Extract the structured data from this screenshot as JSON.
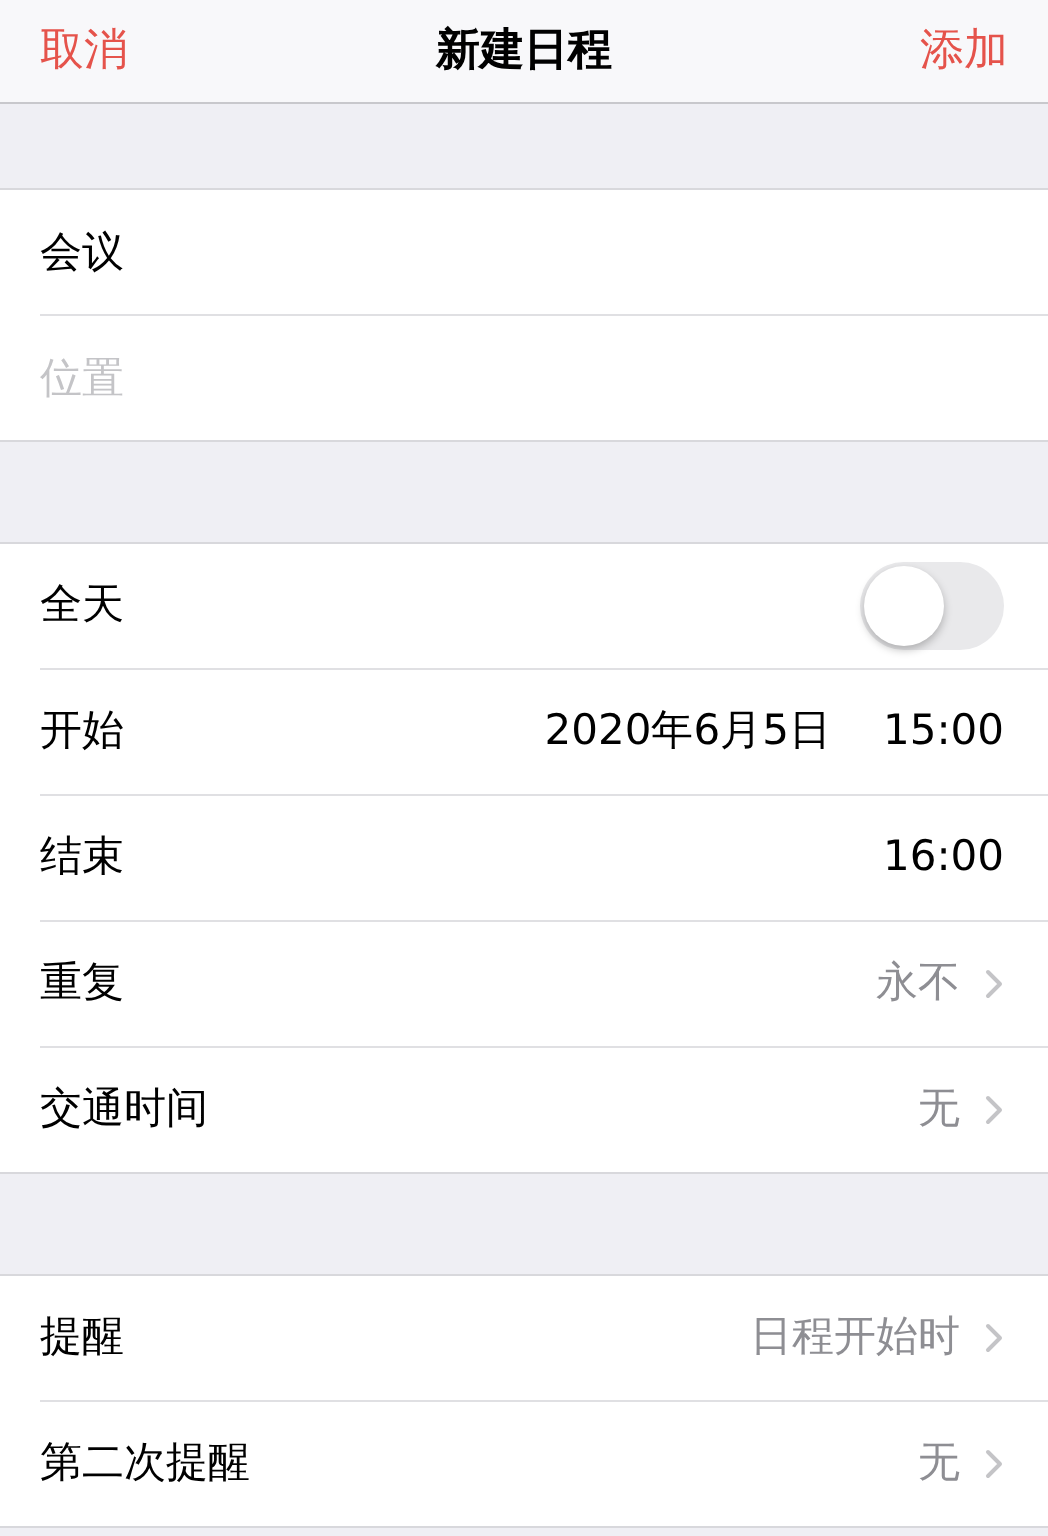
{
  "nav": {
    "cancel": "取消",
    "title": "新建日程",
    "add": "添加"
  },
  "sections": [
    {
      "rows": [
        {
          "kind": "input",
          "value": "会议"
        },
        {
          "kind": "input",
          "placeholder": "位置"
        }
      ]
    },
    {
      "rows": [
        {
          "kind": "toggle",
          "label": "全天",
          "on": false
        },
        {
          "kind": "datetime",
          "label": "开始",
          "date": "2020年6月5日",
          "time": "15:00"
        },
        {
          "kind": "datetime",
          "label": "结束",
          "time": "16:00"
        },
        {
          "kind": "link",
          "label": "重复",
          "value": "永不"
        },
        {
          "kind": "link",
          "label": "交通时间",
          "value": "无"
        }
      ]
    },
    {
      "rows": [
        {
          "kind": "link",
          "label": "提醒",
          "value": "日程开始时"
        },
        {
          "kind": "link",
          "label": "第二次提醒",
          "value": "无"
        }
      ]
    }
  ]
}
